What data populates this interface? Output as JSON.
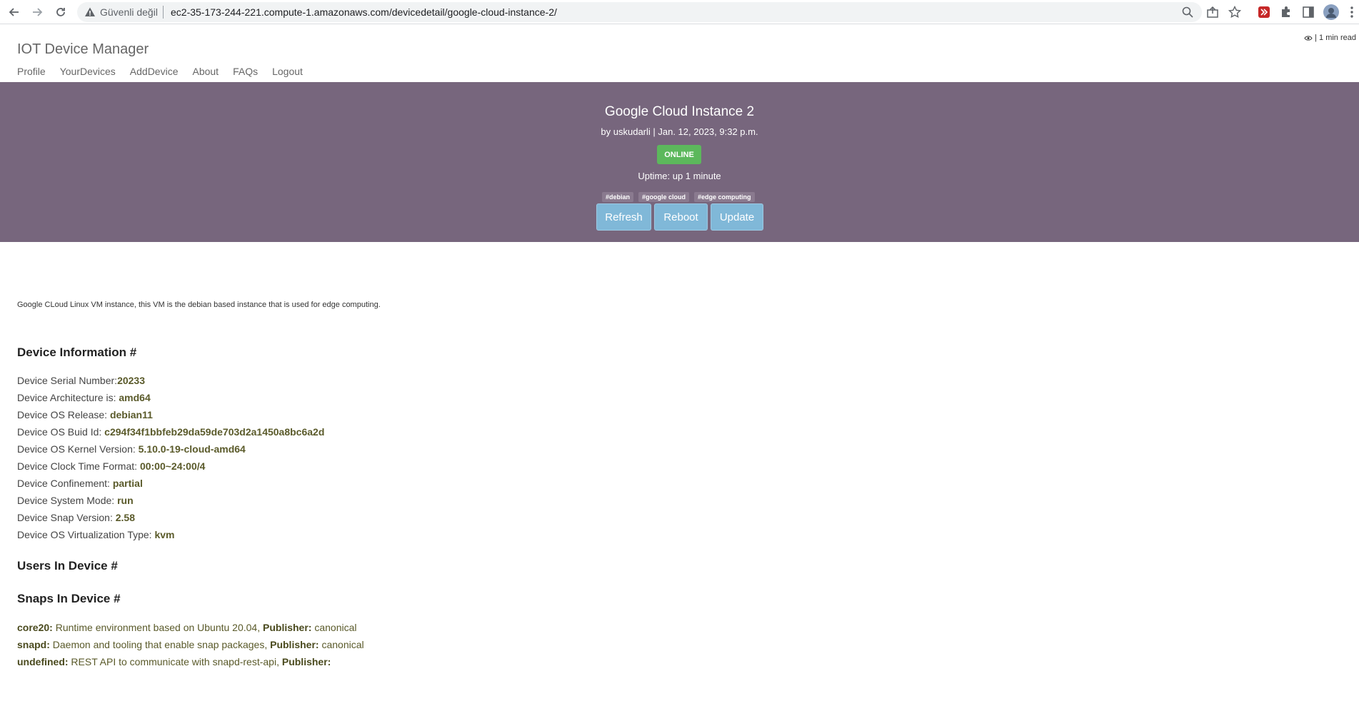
{
  "browser": {
    "security_label": "Güvenli değil",
    "url": "ec2-35-173-244-221.compute-1.amazonaws.com/devicedetail/google-cloud-instance-2/"
  },
  "app": {
    "brand": "IOT Device Manager",
    "read_time": "| 1 min read",
    "nav": [
      "Profile",
      "YourDevices",
      "AddDevice",
      "About",
      "FAQs",
      "Logout"
    ]
  },
  "hero": {
    "title": "Google Cloud Instance 2",
    "meta": "by uskudarli | Jan. 12, 2023, 9:32 p.m.",
    "status": "ONLINE",
    "status_color": "#5cb85c",
    "uptime": "Uptime: up 1 minute",
    "tags": [
      "#debian",
      "#google cloud",
      "#edge computing"
    ],
    "actions": [
      "Refresh",
      "Reboot",
      "Update"
    ],
    "background_color": "#77667d"
  },
  "description": "Google CLoud Linux VM instance, this VM is the debian based instance that is used for edge computing.",
  "device_info": {
    "heading": "Device Information #",
    "rows": [
      {
        "label": "Device Serial Number:",
        "value": "20233"
      },
      {
        "label": "Device Architecture is: ",
        "value": "amd64"
      },
      {
        "label": "Device OS Release: ",
        "value": "debian11"
      },
      {
        "label": "Device OS Buid Id: ",
        "value": "c294f34f1bbfeb29da59de703d2a1450a8bc6a2d"
      },
      {
        "label": "Device OS Kernel Version: ",
        "value": "5.10.0-19-cloud-amd64"
      },
      {
        "label": "Device Clock Time Format: ",
        "value": "00:00~24:00/4"
      },
      {
        "label": "Device Confinement: ",
        "value": "partial"
      },
      {
        "label": "Device System Mode: ",
        "value": "run"
      },
      {
        "label": "Device Snap Version: ",
        "value": "2.58"
      },
      {
        "label": "Device OS Virtualization Type: ",
        "value": "kvm"
      }
    ]
  },
  "users": {
    "heading": "Users In Device #"
  },
  "snaps": {
    "heading": "Snaps In Device #",
    "publisher_label": "Publisher:",
    "rows": [
      {
        "name": "core20:",
        "description": " Runtime environment based on Ubuntu 20.04, ",
        "publisher": " canonical"
      },
      {
        "name": "snapd:",
        "description": " Daemon and tooling that enable snap packages, ",
        "publisher": " canonical"
      },
      {
        "name": "undefined:",
        "description": " REST API to communicate with snapd-rest-api, ",
        "publisher": ""
      }
    ]
  }
}
